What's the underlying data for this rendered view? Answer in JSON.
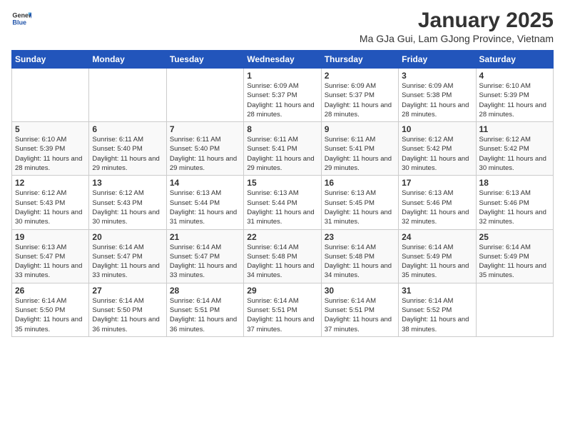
{
  "logo": {
    "general": "General",
    "blue": "Blue"
  },
  "header": {
    "title": "January 2025",
    "subtitle": "Ma GJa Gui, Lam GJong Province, Vietnam"
  },
  "weekdays": [
    "Sunday",
    "Monday",
    "Tuesday",
    "Wednesday",
    "Thursday",
    "Friday",
    "Saturday"
  ],
  "weeks": [
    [
      {
        "day": "",
        "sunrise": "",
        "sunset": "",
        "daylight": ""
      },
      {
        "day": "",
        "sunrise": "",
        "sunset": "",
        "daylight": ""
      },
      {
        "day": "",
        "sunrise": "",
        "sunset": "",
        "daylight": ""
      },
      {
        "day": "1",
        "sunrise": "Sunrise: 6:09 AM",
        "sunset": "Sunset: 5:37 PM",
        "daylight": "Daylight: 11 hours and 28 minutes."
      },
      {
        "day": "2",
        "sunrise": "Sunrise: 6:09 AM",
        "sunset": "Sunset: 5:37 PM",
        "daylight": "Daylight: 11 hours and 28 minutes."
      },
      {
        "day": "3",
        "sunrise": "Sunrise: 6:09 AM",
        "sunset": "Sunset: 5:38 PM",
        "daylight": "Daylight: 11 hours and 28 minutes."
      },
      {
        "day": "4",
        "sunrise": "Sunrise: 6:10 AM",
        "sunset": "Sunset: 5:39 PM",
        "daylight": "Daylight: 11 hours and 28 minutes."
      }
    ],
    [
      {
        "day": "5",
        "sunrise": "Sunrise: 6:10 AM",
        "sunset": "Sunset: 5:39 PM",
        "daylight": "Daylight: 11 hours and 28 minutes."
      },
      {
        "day": "6",
        "sunrise": "Sunrise: 6:11 AM",
        "sunset": "Sunset: 5:40 PM",
        "daylight": "Daylight: 11 hours and 29 minutes."
      },
      {
        "day": "7",
        "sunrise": "Sunrise: 6:11 AM",
        "sunset": "Sunset: 5:40 PM",
        "daylight": "Daylight: 11 hours and 29 minutes."
      },
      {
        "day": "8",
        "sunrise": "Sunrise: 6:11 AM",
        "sunset": "Sunset: 5:41 PM",
        "daylight": "Daylight: 11 hours and 29 minutes."
      },
      {
        "day": "9",
        "sunrise": "Sunrise: 6:11 AM",
        "sunset": "Sunset: 5:41 PM",
        "daylight": "Daylight: 11 hours and 29 minutes."
      },
      {
        "day": "10",
        "sunrise": "Sunrise: 6:12 AM",
        "sunset": "Sunset: 5:42 PM",
        "daylight": "Daylight: 11 hours and 30 minutes."
      },
      {
        "day": "11",
        "sunrise": "Sunrise: 6:12 AM",
        "sunset": "Sunset: 5:42 PM",
        "daylight": "Daylight: 11 hours and 30 minutes."
      }
    ],
    [
      {
        "day": "12",
        "sunrise": "Sunrise: 6:12 AM",
        "sunset": "Sunset: 5:43 PM",
        "daylight": "Daylight: 11 hours and 30 minutes."
      },
      {
        "day": "13",
        "sunrise": "Sunrise: 6:12 AM",
        "sunset": "Sunset: 5:43 PM",
        "daylight": "Daylight: 11 hours and 30 minutes."
      },
      {
        "day": "14",
        "sunrise": "Sunrise: 6:13 AM",
        "sunset": "Sunset: 5:44 PM",
        "daylight": "Daylight: 11 hours and 31 minutes."
      },
      {
        "day": "15",
        "sunrise": "Sunrise: 6:13 AM",
        "sunset": "Sunset: 5:44 PM",
        "daylight": "Daylight: 11 hours and 31 minutes."
      },
      {
        "day": "16",
        "sunrise": "Sunrise: 6:13 AM",
        "sunset": "Sunset: 5:45 PM",
        "daylight": "Daylight: 11 hours and 31 minutes."
      },
      {
        "day": "17",
        "sunrise": "Sunrise: 6:13 AM",
        "sunset": "Sunset: 5:46 PM",
        "daylight": "Daylight: 11 hours and 32 minutes."
      },
      {
        "day": "18",
        "sunrise": "Sunrise: 6:13 AM",
        "sunset": "Sunset: 5:46 PM",
        "daylight": "Daylight: 11 hours and 32 minutes."
      }
    ],
    [
      {
        "day": "19",
        "sunrise": "Sunrise: 6:13 AM",
        "sunset": "Sunset: 5:47 PM",
        "daylight": "Daylight: 11 hours and 33 minutes."
      },
      {
        "day": "20",
        "sunrise": "Sunrise: 6:14 AM",
        "sunset": "Sunset: 5:47 PM",
        "daylight": "Daylight: 11 hours and 33 minutes."
      },
      {
        "day": "21",
        "sunrise": "Sunrise: 6:14 AM",
        "sunset": "Sunset: 5:47 PM",
        "daylight": "Daylight: 11 hours and 33 minutes."
      },
      {
        "day": "22",
        "sunrise": "Sunrise: 6:14 AM",
        "sunset": "Sunset: 5:48 PM",
        "daylight": "Daylight: 11 hours and 34 minutes."
      },
      {
        "day": "23",
        "sunrise": "Sunrise: 6:14 AM",
        "sunset": "Sunset: 5:48 PM",
        "daylight": "Daylight: 11 hours and 34 minutes."
      },
      {
        "day": "24",
        "sunrise": "Sunrise: 6:14 AM",
        "sunset": "Sunset: 5:49 PM",
        "daylight": "Daylight: 11 hours and 35 minutes."
      },
      {
        "day": "25",
        "sunrise": "Sunrise: 6:14 AM",
        "sunset": "Sunset: 5:49 PM",
        "daylight": "Daylight: 11 hours and 35 minutes."
      }
    ],
    [
      {
        "day": "26",
        "sunrise": "Sunrise: 6:14 AM",
        "sunset": "Sunset: 5:50 PM",
        "daylight": "Daylight: 11 hours and 35 minutes."
      },
      {
        "day": "27",
        "sunrise": "Sunrise: 6:14 AM",
        "sunset": "Sunset: 5:50 PM",
        "daylight": "Daylight: 11 hours and 36 minutes."
      },
      {
        "day": "28",
        "sunrise": "Sunrise: 6:14 AM",
        "sunset": "Sunset: 5:51 PM",
        "daylight": "Daylight: 11 hours and 36 minutes."
      },
      {
        "day": "29",
        "sunrise": "Sunrise: 6:14 AM",
        "sunset": "Sunset: 5:51 PM",
        "daylight": "Daylight: 11 hours and 37 minutes."
      },
      {
        "day": "30",
        "sunrise": "Sunrise: 6:14 AM",
        "sunset": "Sunset: 5:51 PM",
        "daylight": "Daylight: 11 hours and 37 minutes."
      },
      {
        "day": "31",
        "sunrise": "Sunrise: 6:14 AM",
        "sunset": "Sunset: 5:52 PM",
        "daylight": "Daylight: 11 hours and 38 minutes."
      },
      {
        "day": "",
        "sunrise": "",
        "sunset": "",
        "daylight": ""
      }
    ]
  ]
}
